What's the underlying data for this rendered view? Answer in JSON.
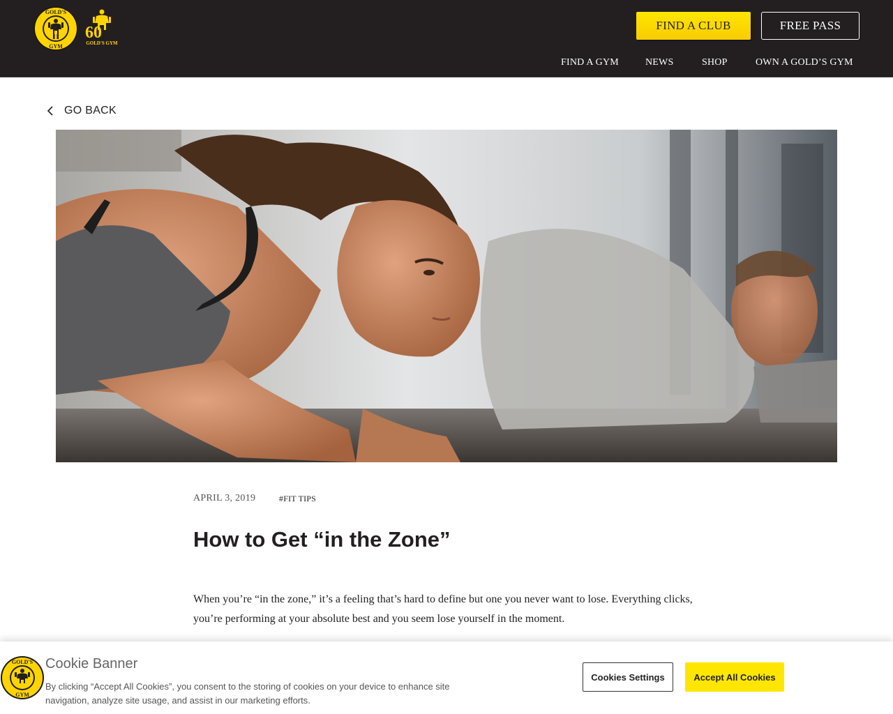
{
  "header": {
    "logo_alt": "Gold's Gym",
    "logo_text_top": "GOLD'S",
    "logo_text_bottom": "GYM",
    "anniversary_number": "60",
    "anniversary_text": "GOLD'S GYM",
    "find_club_label": "FIND A CLUB",
    "free_pass_label": "FREE PASS",
    "nav": [
      "FIND A GYM",
      "NEWS",
      "SHOP",
      "OWN A GOLD’S GYM"
    ],
    "colors": {
      "background": "#231f20",
      "accent": "#ffe600"
    }
  },
  "go_back": {
    "label": "GO BACK",
    "icon": "chevron-left-icon"
  },
  "hero": {
    "description_icon": "hero-image"
  },
  "article": {
    "date": "APRIL 3, 2019",
    "tag": "#FIT TIPS",
    "title": "How to Get “in the Zone”",
    "paragraph": "When you’re “in the zone,” it’s a feeling that’s hard to define but one you never want to lose. Everything clicks, you’re performing at your absolute best and you seem lose yourself in the moment."
  },
  "cookie_banner": {
    "title": "Cookie Banner",
    "text": "By clicking “Accept All Cookies”, you consent to the storing of cookies on your device to enhance site navigation, analyze site usage, and assist in our marketing efforts.",
    "settings_label": "Cookies Settings",
    "accept_label": "Accept All Cookies"
  }
}
